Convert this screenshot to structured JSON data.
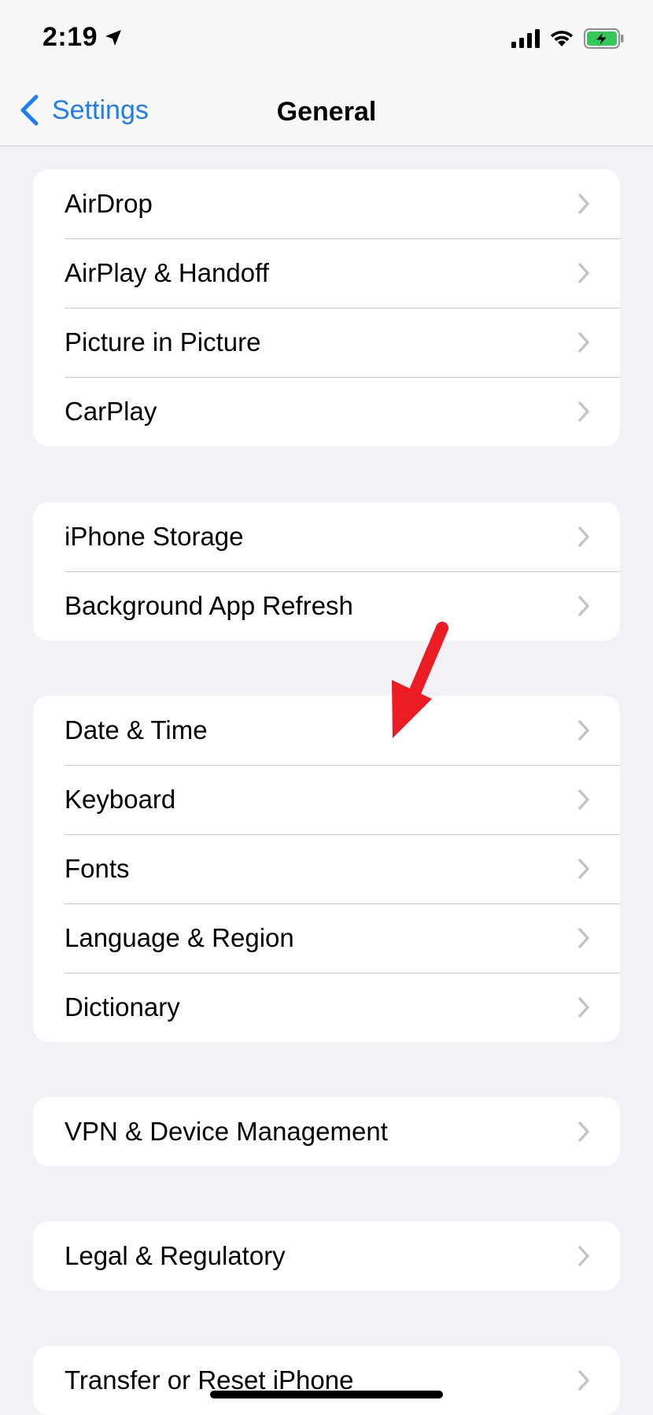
{
  "status_bar": {
    "time": "2:19",
    "icons": [
      "location-arrow-icon",
      "cellular-signal-icon",
      "wifi-icon",
      "battery-charging-icon"
    ],
    "battery_color": "#34c759"
  },
  "nav": {
    "back_label": "Settings",
    "title": "General",
    "accent_color": "#1e7cf5"
  },
  "groups": [
    {
      "items": [
        "AirDrop",
        "AirPlay & Handoff",
        "Picture in Picture",
        "CarPlay"
      ]
    },
    {
      "items": [
        "iPhone Storage",
        "Background App Refresh"
      ]
    },
    {
      "items": [
        "Date & Time",
        "Keyboard",
        "Fonts",
        "Language & Region",
        "Dictionary"
      ]
    },
    {
      "items": [
        "VPN & Device Management"
      ]
    },
    {
      "items": [
        "Legal & Regulatory"
      ]
    },
    {
      "items": [
        "Transfer or Reset iPhone"
      ]
    }
  ],
  "annotation": {
    "icon": "red-arrow-icon",
    "color": "#ec1c24",
    "points_to": "Date & Time"
  }
}
